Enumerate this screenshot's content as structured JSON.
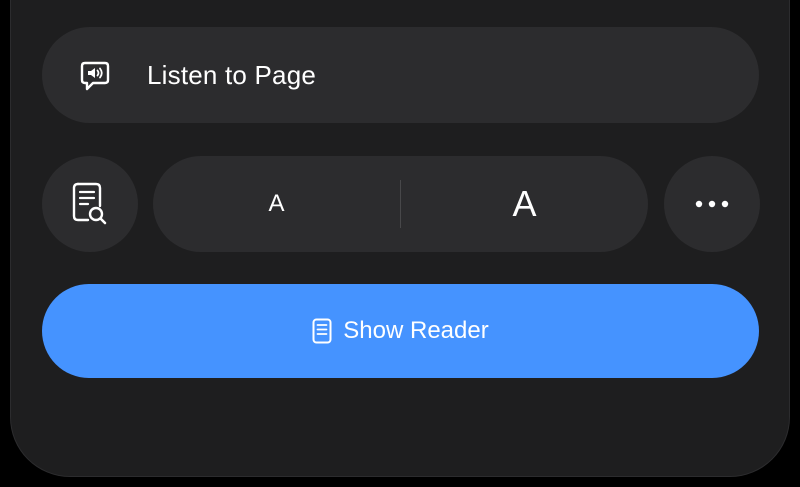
{
  "listen": {
    "label": "Listen to Page",
    "icon": "speech-bubble-speaker-icon"
  },
  "find": {
    "icon": "find-on-page-icon"
  },
  "font_size": {
    "smaller_label": "A",
    "larger_label": "A"
  },
  "more": {
    "icon": "ellipsis-icon"
  },
  "reader": {
    "label": "Show Reader",
    "icon": "reader-document-icon"
  },
  "colors": {
    "background": "#000000",
    "sheet": "#1e1e1f",
    "control": "#2c2c2e",
    "accent": "#4593ff",
    "text": "#ffffff"
  }
}
